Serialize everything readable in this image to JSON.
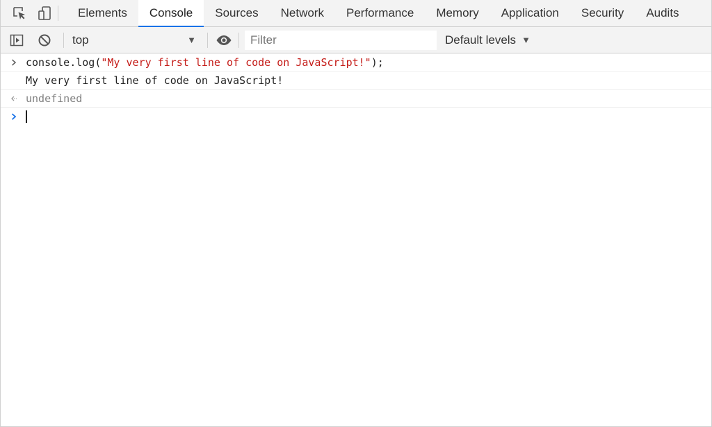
{
  "tabs": [
    {
      "label": "Elements",
      "active": false
    },
    {
      "label": "Console",
      "active": true
    },
    {
      "label": "Sources",
      "active": false
    },
    {
      "label": "Network",
      "active": false
    },
    {
      "label": "Performance",
      "active": false
    },
    {
      "label": "Memory",
      "active": false
    },
    {
      "label": "Application",
      "active": false
    },
    {
      "label": "Security",
      "active": false
    },
    {
      "label": "Audits",
      "active": false
    }
  ],
  "toolbar_icons": {
    "inspect": "inspect-element-icon",
    "device": "device-toolbar-icon",
    "sidebar": "show-sidebar-icon",
    "clear": "clear-console-icon",
    "live_expression": "eye-icon"
  },
  "console_toolbar": {
    "context_value": "top",
    "context_arrow": "▼",
    "filter_placeholder": "Filter",
    "filter_value": "",
    "levels_label": "Default levels",
    "levels_arrow": "▼"
  },
  "console": {
    "command": {
      "prefix": "console.log(",
      "string": "\"My very first line of code on JavaScript!\"",
      "suffix": ");"
    },
    "log_output": "My very first line of code on JavaScript!",
    "result": "undefined",
    "prompt_value": ""
  },
  "colors": {
    "accent": "#1a73e8",
    "string": "#c41a16",
    "prompt": "#1a73e8",
    "result": "#808080",
    "toolbar_bg": "#f3f3f3"
  }
}
